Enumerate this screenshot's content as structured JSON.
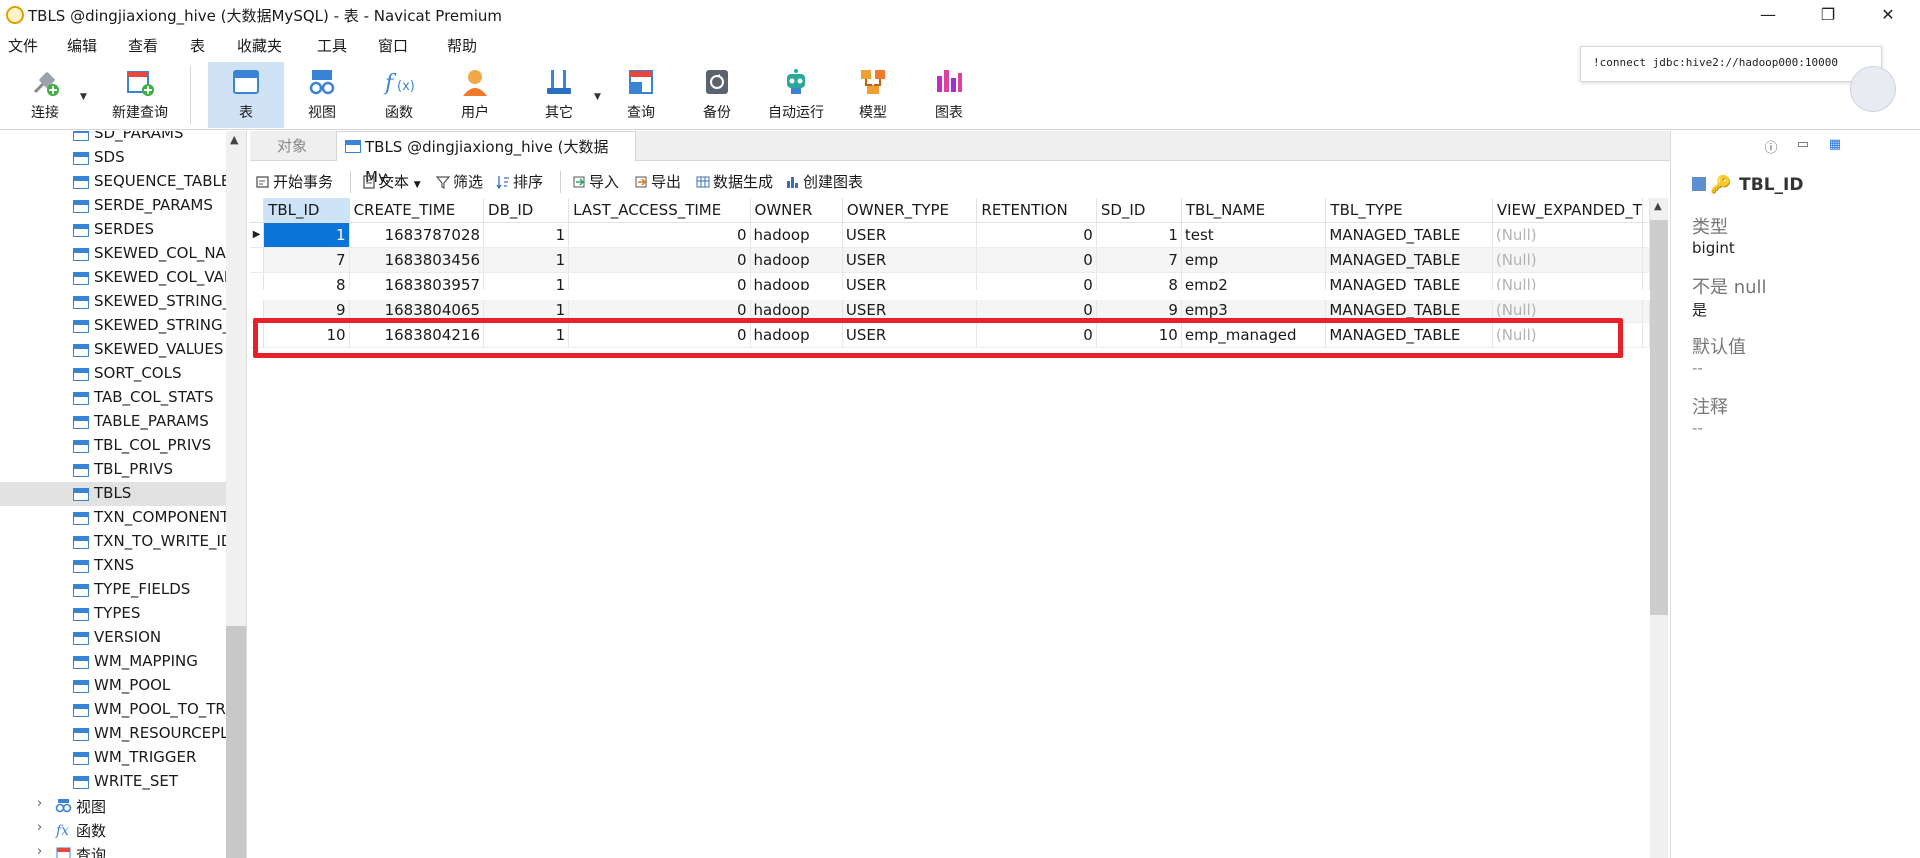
{
  "window": {
    "title": "TBLS @dingjiaxiong_hive (大数据MySQL) - 表 - Navicat Premium",
    "minimize": "—",
    "maximize": "❐",
    "close": "✕"
  },
  "menu": [
    "文件",
    "编辑",
    "查看",
    "表",
    "收藏夹",
    "工具",
    "窗口",
    "帮助"
  ],
  "toolbar": {
    "connect": "连接",
    "new_query": "新建查询",
    "table": "表",
    "view": "视图",
    "function": "函数",
    "user": "用户",
    "other": "其它",
    "query": "查询",
    "backup": "备份",
    "auto_run": "自动运行",
    "model": "模型",
    "chart": "图表"
  },
  "tooltip": "!connect jdbc:hive2://hadoop000:10000",
  "tree": {
    "tables": [
      "SD_PARAMS",
      "SDS",
      "SEQUENCE_TABLE",
      "SERDE_PARAMS",
      "SERDES",
      "SKEWED_COL_NAI",
      "SKEWED_COL_VAL",
      "SKEWED_STRING_",
      "SKEWED_STRING_",
      "SKEWED_VALUES",
      "SORT_COLS",
      "TAB_COL_STATS",
      "TABLE_PARAMS",
      "TBL_COL_PRIVS",
      "TBL_PRIVS",
      "TBLS",
      "TXN_COMPONENT",
      "TXN_TO_WRITE_ID",
      "TXNS",
      "TYPE_FIELDS",
      "TYPES",
      "VERSION",
      "WM_MAPPING",
      "WM_POOL",
      "WM_POOL_TO_TR",
      "WM_RESOURCEPL",
      "WM_TRIGGER",
      "WRITE_SET"
    ],
    "selected": "TBLS",
    "groups": [
      "视图",
      "函数",
      "查询"
    ]
  },
  "tabs": {
    "objects": "对象",
    "active": "TBLS @dingjiaxiong_hive (大数据My..."
  },
  "data_toolbar": {
    "begin_tx": "开始事务",
    "text": "文本",
    "filter": "筛选",
    "sort": "排序",
    "import": "导入",
    "export": "导出",
    "generate": "数据生成",
    "create_chart": "创建图表"
  },
  "grid": {
    "columns": [
      "TBL_ID",
      "CREATE_TIME",
      "DB_ID",
      "LAST_ACCESS_TIME",
      "OWNER",
      "OWNER_TYPE",
      "RETENTION",
      "SD_ID",
      "TBL_NAME",
      "TBL_TYPE",
      "VIEW_EXPANDED_T"
    ],
    "rows": [
      [
        "1",
        "1683787028",
        "1",
        "0",
        "hadoop",
        "USER",
        "0",
        "1",
        "test",
        "MANAGED_TABLE",
        "(Null)"
      ],
      [
        "7",
        "1683803456",
        "1",
        "0",
        "hadoop",
        "USER",
        "0",
        "7",
        "emp",
        "MANAGED_TABLE",
        "(Null)"
      ],
      [
        "8",
        "1683803957",
        "1",
        "0",
        "hadoop",
        "USER",
        "0",
        "8",
        "emp2",
        "MANAGED_TABLE",
        "(Null)"
      ],
      [
        "9",
        "1683804065",
        "1",
        "0",
        "hadoop",
        "USER",
        "0",
        "9",
        "emp3",
        "MANAGED_TABLE",
        "(Null)"
      ],
      [
        "10",
        "1683804216",
        "1",
        "0",
        "hadoop",
        "USER",
        "0",
        "10",
        "emp_managed",
        "MANAGED_TABLE",
        "(Null)"
      ]
    ],
    "highlight_color": "#e8202a"
  },
  "panel": {
    "field_name": "TBL_ID",
    "type_label": "类型",
    "type_value": "bigint",
    "notnull_label": "不是 null",
    "notnull_value": "是",
    "default_label": "默认值",
    "default_value": "--",
    "comment_label": "注释",
    "comment_value": "--"
  }
}
